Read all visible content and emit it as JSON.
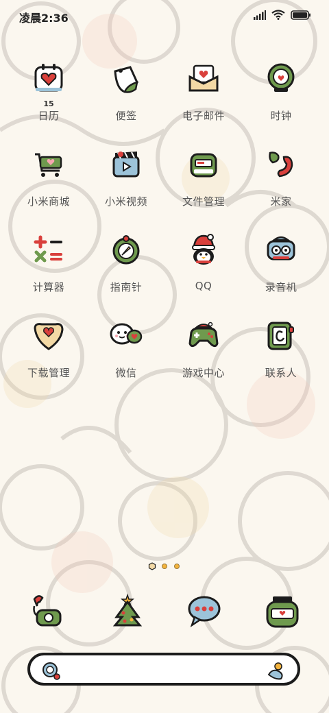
{
  "status_bar": {
    "time": "凌晨2:36",
    "icons": [
      "cellular-signal-icon",
      "wifi-icon",
      "battery-icon"
    ]
  },
  "apps": [
    {
      "label": "日历",
      "icon": "calendar-icon",
      "badge": "15"
    },
    {
      "label": "便签",
      "icon": "notes-icon"
    },
    {
      "label": "电子邮件",
      "icon": "email-icon"
    },
    {
      "label": "时钟",
      "icon": "clock-icon"
    },
    {
      "label": "小米商城",
      "icon": "shopping-cart-icon"
    },
    {
      "label": "小米视频",
      "icon": "video-icon"
    },
    {
      "label": "文件管理",
      "icon": "file-manager-icon"
    },
    {
      "label": "米家",
      "icon": "mijia-icon"
    },
    {
      "label": "计算器",
      "icon": "calculator-icon"
    },
    {
      "label": "指南针",
      "icon": "compass-icon"
    },
    {
      "label": "QQ",
      "icon": "penguin-icon"
    },
    {
      "label": "录音机",
      "icon": "recorder-icon"
    },
    {
      "label": "下载管理",
      "icon": "download-icon"
    },
    {
      "label": "微信",
      "icon": "chat-bubbles-icon"
    },
    {
      "label": "游戏中心",
      "icon": "gamepad-icon"
    },
    {
      "label": "联系人",
      "icon": "contacts-icon"
    }
  ],
  "page_indicators": [
    "page-dot-1",
    "page-dot-2",
    "page-dot-3"
  ],
  "dock": [
    {
      "icon": "phone-icon"
    },
    {
      "icon": "tree-icon"
    },
    {
      "icon": "message-icon"
    },
    {
      "icon": "browser-jar-icon"
    }
  ],
  "search_bar": {
    "left_icon": "assistant-icon",
    "right_icon": "search-fish-icon"
  },
  "colors": {
    "red": "#d9403c",
    "green": "#6f9a4e",
    "cream": "#f3d9a5",
    "outline": "#1c1c1c",
    "label": "#555555"
  }
}
